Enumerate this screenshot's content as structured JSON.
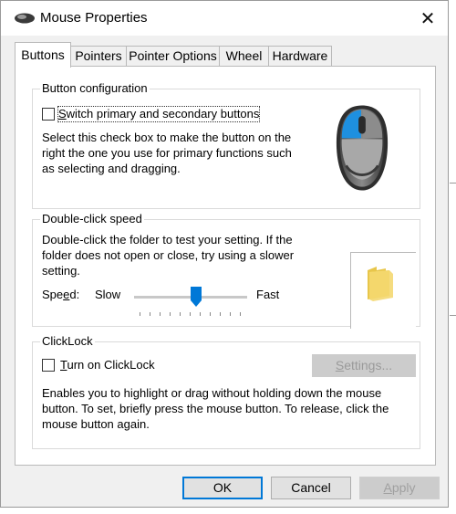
{
  "window": {
    "title": "Mouse Properties",
    "close_glyph": "✕"
  },
  "tabs": [
    {
      "label": "Buttons",
      "active": true
    },
    {
      "label": "Pointers",
      "active": false
    },
    {
      "label": "Pointer Options",
      "active": false
    },
    {
      "label": "Wheel",
      "active": false
    },
    {
      "label": "Hardware",
      "active": false
    }
  ],
  "button_config": {
    "title": "Button configuration",
    "switch_label_first": "S",
    "switch_label_rest": "witch primary and secondary buttons",
    "switch_checked": false,
    "description": "Select this check box to make the button on the right the one you use for primary functions such as selecting and dragging."
  },
  "double_click": {
    "title": "Double-click speed",
    "description": "Double-click the folder to test your setting. If the folder does not open or close, try using a slower setting.",
    "speed_label_pre": "Spe",
    "speed_label_ul": "e",
    "speed_label_post": "d:",
    "slow_label": "Slow",
    "fast_label": "Fast",
    "speed_level": 0.55
  },
  "clicklock": {
    "title": "ClickLock",
    "checkbox_label_first": "T",
    "checkbox_label_rest": "urn on ClickLock",
    "checked": false,
    "settings_label_first": "S",
    "settings_label_rest": "ettings...",
    "description": "Enables you to highlight or drag without holding down the mouse button. To set, briefly press the mouse button. To release, click the mouse button again."
  },
  "footer": {
    "ok": "OK",
    "cancel": "Cancel",
    "apply_first": "A",
    "apply_rest": "pply"
  },
  "colors": {
    "accent": "#0078d7",
    "mouse_button_blue": "#1e90e0"
  }
}
